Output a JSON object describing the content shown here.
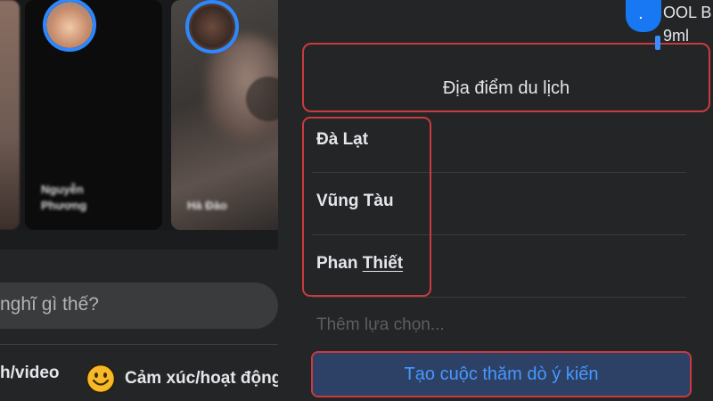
{
  "feed": {
    "stories": [
      {
        "name": ""
      },
      {
        "name": "Nguyễn Phương"
      },
      {
        "name": "Hà Đào"
      }
    ],
    "composer": {
      "placeholder": "nghĩ gì thế?",
      "actions": [
        {
          "label": "h/video",
          "icon": "photo-icon"
        },
        {
          "label": "Cảm xúc/hoạt động",
          "icon": "smiley-icon"
        }
      ]
    }
  },
  "background_text": {
    "chip": ".",
    "line1": "OOL B",
    "line2": "9ml"
  },
  "poll": {
    "question": "Địa điểm du lịch",
    "options": [
      {
        "label": "Đà Lạt"
      },
      {
        "label": "Vũng Tàu"
      },
      {
        "label_plain": "Phan ",
        "label_underlined": "Thiết"
      }
    ],
    "add_option_placeholder": "Thêm lựa chọn...",
    "submit_label": "Tạo cuộc thăm dò ý kiến"
  },
  "colors": {
    "background": "#18191a",
    "panel": "#242526",
    "highlight": "#c93b3f",
    "primary": "#4599ff",
    "story_ring": "#2d88ff"
  }
}
